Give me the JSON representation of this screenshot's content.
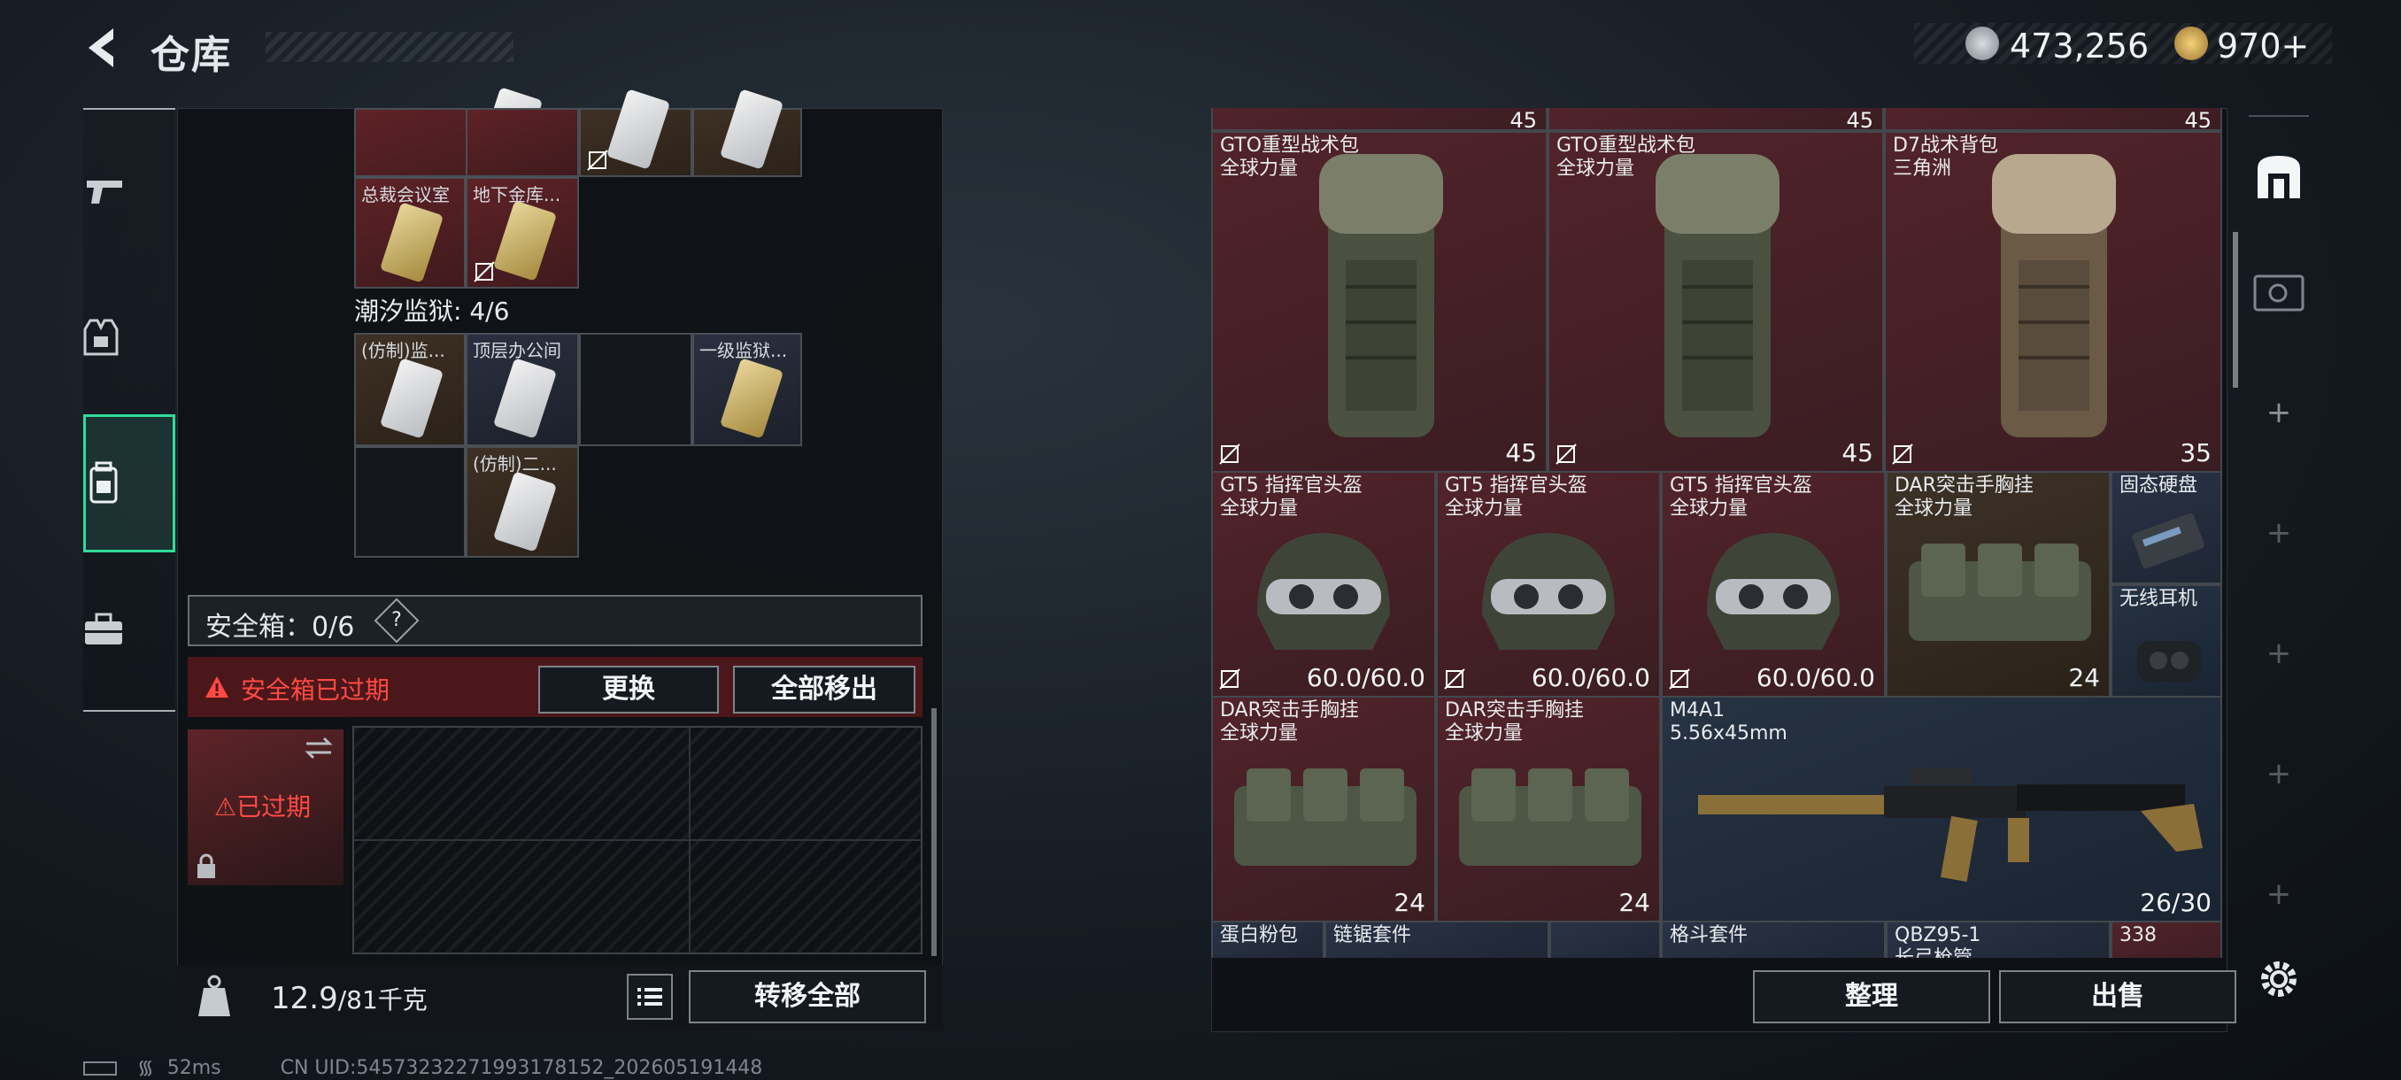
{
  "header": {
    "title": "仓库"
  },
  "currency": {
    "coins": "473,256",
    "premium": "970+"
  },
  "rail": {
    "items": [
      "weapon",
      "equipment",
      "backpack",
      "toolbox"
    ],
    "active": "backpack"
  },
  "left": {
    "top_row_count": 4,
    "cards_row1": [
      {
        "label": "总裁会议室",
        "color": "red",
        "card": "gold"
      },
      {
        "label": "地下金库...",
        "color": "red",
        "card": "gold",
        "locked": true
      }
    ],
    "prison_label": "潮汐监狱: 4/6",
    "prison_cards": [
      {
        "label": "(仿制)监...",
        "color": "brown",
        "card": "white"
      },
      {
        "label": "顶层办公间",
        "color": "navy",
        "card": "white"
      },
      {
        "label": "",
        "color": "dark"
      },
      {
        "label": "一级监狱...",
        "color": "navy",
        "card": "gold"
      },
      {
        "label": "",
        "color": "dark"
      },
      {
        "label": "(仿制)二...",
        "color": "brown",
        "card": "white"
      }
    ],
    "safe_label": "安全箱：0/6",
    "safe_help": "?",
    "expired_text": "安全箱已过期",
    "replace_label": "更换",
    "moveall_label": "全部移出",
    "case_expired": "已过期",
    "weight_value": "12.9",
    "weight_max": "/81千克",
    "transfer_label": "转移全部"
  },
  "right": {
    "top_counts": [
      "45",
      "45",
      "45"
    ],
    "backpacks": [
      {
        "name": "GTO重型战术包",
        "sub": "全球力量",
        "value": "45"
      },
      {
        "name": "GTO重型战术包",
        "sub": "全球力量",
        "value": "45"
      },
      {
        "name": "D7战术背包",
        "sub": "三角洲",
        "value": "35"
      }
    ],
    "helmets": [
      {
        "name": "GT5 指挥官头盔",
        "sub": "全球力量",
        "value": "60.0/60.0"
      },
      {
        "name": "GT5 指挥官头盔",
        "sub": "全球力量",
        "value": "60.0/60.0"
      },
      {
        "name": "GT5 指挥官头盔",
        "sub": "全球力量",
        "value": "60.0/60.0"
      }
    ],
    "rig1": {
      "name": "DAR突击手胸挂",
      "sub": "全球力量",
      "value": "24"
    },
    "ssd": {
      "name": "固态硬盘"
    },
    "earphone": {
      "name": "无线耳机"
    },
    "rigs": [
      {
        "name": "DAR突击手胸挂",
        "sub": "全球力量",
        "value": "24"
      },
      {
        "name": "DAR突击手胸挂",
        "sub": "全球力量",
        "value": "24"
      }
    ],
    "rifle": {
      "name": "M4A1",
      "sub": "5.56x45mm",
      "value": "26/30"
    },
    "bottom_items": [
      "蛋白粉包",
      "链锯套件",
      "格斗套件",
      "QBZ95-1",
      "338"
    ],
    "bottom_subs": [
      "长弓枪管"
    ],
    "tidy_label": "整理",
    "sell_label": "出售"
  },
  "status": {
    "ping": "52ms",
    "uid": "CN UID:54573232271993178152_202605191448"
  }
}
